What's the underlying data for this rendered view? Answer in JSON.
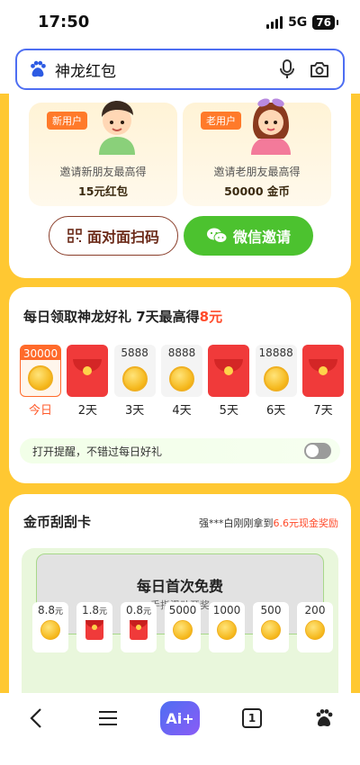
{
  "status": {
    "time": "17:50",
    "network": "5G",
    "battery": "76"
  },
  "search": {
    "query": "神龙红包"
  },
  "invite": {
    "new_user": {
      "tag": "新用户",
      "desc": "邀请新朋友最高得",
      "reward": "15元红包"
    },
    "old_user": {
      "tag": "老用户",
      "desc": "邀请老朋友最高得",
      "reward": "50000 金币"
    },
    "f2f_label": "面对面扫码",
    "wechat_label": "微信邀请"
  },
  "daily": {
    "title_prefix": "每日领取神龙好礼  7天最高得",
    "title_highlight": "8元",
    "days": [
      {
        "amount": "30000",
        "icon": "coin",
        "label": "今日",
        "active": true
      },
      {
        "amount": "",
        "icon": "envelope",
        "label": "2天"
      },
      {
        "amount": "5888",
        "icon": "coin",
        "label": "3天"
      },
      {
        "amount": "8888",
        "icon": "coin",
        "label": "4天"
      },
      {
        "amount": "",
        "icon": "envelope",
        "label": "5天"
      },
      {
        "amount": "18888",
        "icon": "coin",
        "label": "6天"
      },
      {
        "amount": "",
        "icon": "envelope",
        "label": "7天"
      }
    ],
    "remind_text": "打开提醒，不错过每日好礼",
    "remind_on": false
  },
  "scratch": {
    "title": "金币刮刮卡",
    "notice_prefix": "强***白刚刚拿到",
    "notice_highlight": "6.6元现金奖励",
    "card_title": "每日首次免费",
    "card_sub": "手指滑动开奖",
    "prizes": [
      {
        "value": "8.8",
        "unit": "元",
        "icon": "coin"
      },
      {
        "value": "1.8",
        "unit": "元",
        "icon": "envelope"
      },
      {
        "value": "0.8",
        "unit": "元",
        "icon": "envelope"
      },
      {
        "value": "5000",
        "unit": "",
        "icon": "coin"
      },
      {
        "value": "1000",
        "unit": "",
        "icon": "coin"
      },
      {
        "value": "500",
        "unit": "",
        "icon": "coin"
      },
      {
        "value": "200",
        "unit": "",
        "icon": "coin"
      }
    ]
  },
  "nav": {
    "ai_label": "Ai+",
    "tab_count": "1"
  }
}
